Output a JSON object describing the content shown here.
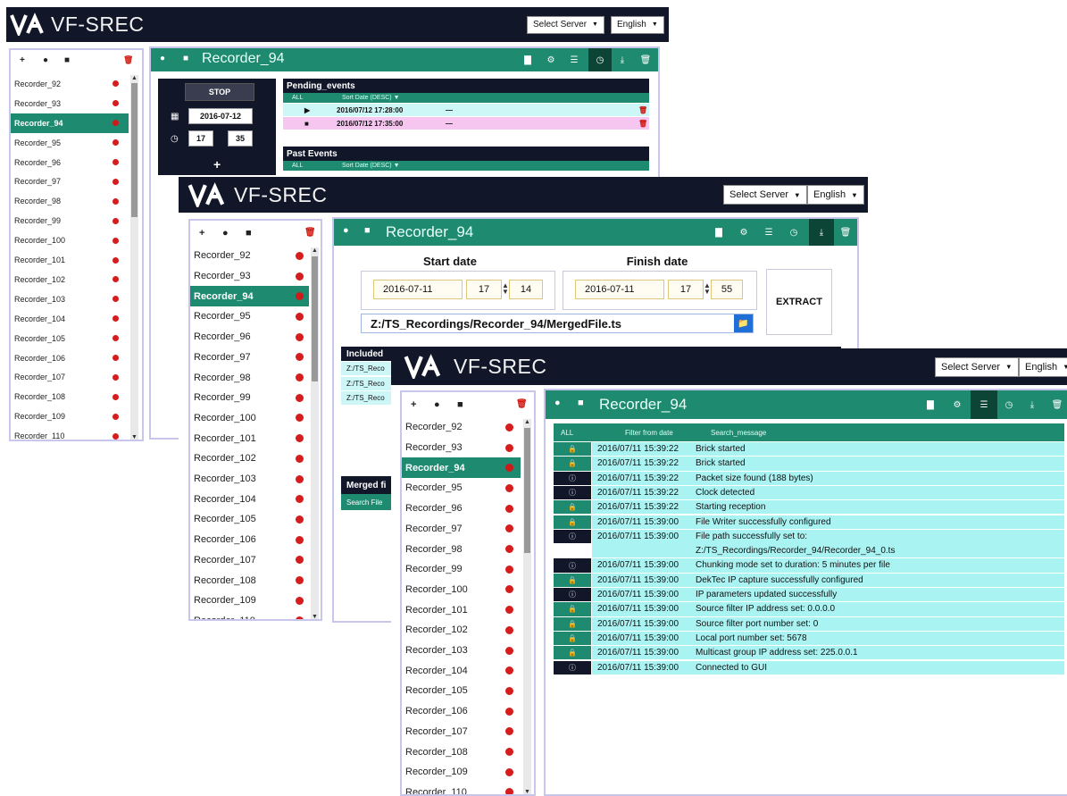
{
  "app": {
    "brand": "VF-SREC",
    "server_select": "Select Server",
    "language_select": "English"
  },
  "sidebar_tools": {
    "add": "+",
    "record": "●",
    "stop": "■",
    "delete": "🗑"
  },
  "recorders": [
    "Recorder_92",
    "Recorder_93",
    "Recorder_94",
    "Recorder_95",
    "Recorder_96",
    "Recorder_97",
    "Recorder_98",
    "Recorder_99",
    "Recorder_100",
    "Recorder_101",
    "Recorder_102",
    "Recorder_103",
    "Recorder_104",
    "Recorder_105",
    "Recorder_106",
    "Recorder_107",
    "Recorder_108",
    "Recorder_109",
    "Recorder_110"
  ],
  "selected_recorder": "Recorder_94",
  "main_title": "Recorder_94",
  "scheduler": {
    "stop_label": "STOP",
    "date": "2016-07-12",
    "hour": "17",
    "minute": "35",
    "add": "+",
    "pending_title": "Pending_events",
    "past_title": "Past Events",
    "filter_all": "ALL",
    "sort_label": "Sort Date (DESC)",
    "pending_events": [
      {
        "icon": "▶",
        "datetime": "2016/07/12 17:28:00",
        "dash": "—"
      },
      {
        "icon": "■",
        "datetime": "2016/07/12 17:35:00",
        "dash": "—"
      }
    ]
  },
  "extract": {
    "start_label": "Start date",
    "finish_label": "Finish date",
    "start_date": "2016-07-11",
    "start_hour": "17",
    "start_minute": "14",
    "finish_date": "2016-07-11",
    "finish_hour": "17",
    "finish_minute": "55",
    "button": "EXTRACT",
    "path": "Z:/TS_Recordings/Recorder_94/MergedFile.ts",
    "included_title": "Included",
    "included_rows": [
      "Z:/TS_Reco",
      "Z:/TS_Reco",
      "Z:/TS_Reco"
    ],
    "merged_title": "Merged fi",
    "search_row": "Search File"
  },
  "log": {
    "filter_all": "ALL",
    "filter_date": "Filter from date",
    "search": "Search_message",
    "rows": [
      {
        "type": "lock",
        "date": "2016/07/11 15:39:22",
        "msg": "Brick started"
      },
      {
        "type": "lock",
        "date": "2016/07/11 15:39:22",
        "msg": "Brick started"
      },
      {
        "type": "info",
        "date": "2016/07/11 15:39:22",
        "msg": "Packet size found (188 bytes)"
      },
      {
        "type": "info",
        "date": "2016/07/11 15:39:22",
        "msg": "Clock detected"
      },
      {
        "type": "lock",
        "date": "2016/07/11 15:39:22",
        "msg": "Starting reception"
      },
      {
        "type": "lock",
        "date": "2016/07/11 15:39:00",
        "msg": "File Writer successfully configured"
      },
      {
        "type": "info",
        "date": "2016/07/11 15:39:00",
        "msg": "File path successfully set to:",
        "msg2": "Z:/TS_Recordings/Recorder_94/Recorder_94_0.ts"
      },
      {
        "type": "info",
        "date": "2016/07/11 15:39:00",
        "msg": "Chunking mode set to duration: 5 minutes per file"
      },
      {
        "type": "lock",
        "date": "2016/07/11 15:39:00",
        "msg": "DekTec IP capture successfully configured"
      },
      {
        "type": "info",
        "date": "2016/07/11 15:39:00",
        "msg": "IP parameters updated successfully"
      },
      {
        "type": "lock",
        "date": "2016/07/11 15:39:00",
        "msg": "Source filter IP address set: 0.0.0.0"
      },
      {
        "type": "lock",
        "date": "2016/07/11 15:39:00",
        "msg": "Source filter port number set: 0"
      },
      {
        "type": "lock",
        "date": "2016/07/11 15:39:00",
        "msg": "Local port number set: 5678"
      },
      {
        "type": "lock",
        "date": "2016/07/11 15:39:00",
        "msg": "Multicast group IP address set: 225.0.0.1"
      },
      {
        "type": "info",
        "date": "2016/07/11 15:39:00",
        "msg": "Connected to GUI"
      }
    ]
  },
  "colors": {
    "navy": "#121629",
    "teal": "#1e8a70",
    "record_red": "#d61c1c",
    "log_row": "#aaf3f3",
    "pending_highlight": "#f7c6f0"
  }
}
